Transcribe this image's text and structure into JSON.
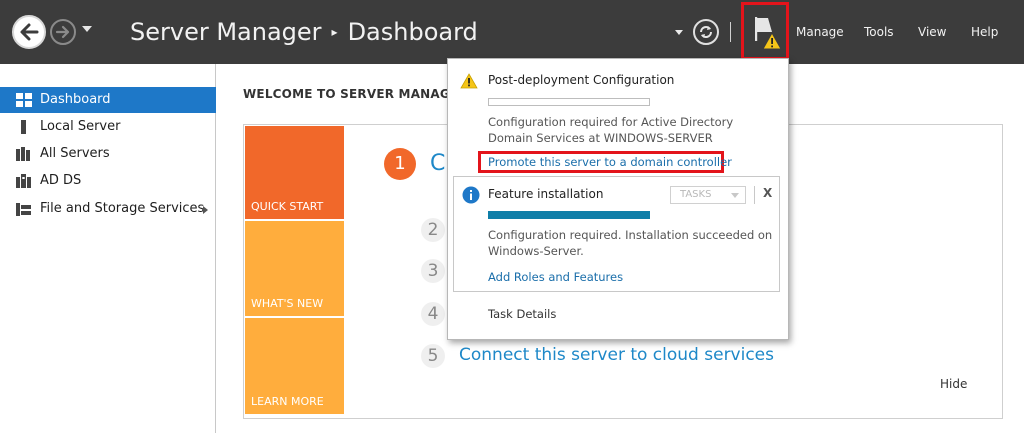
{
  "app": {
    "title": "Server Manager",
    "breadcrumb_separator": "▸",
    "breadcrumb_page": "Dashboard"
  },
  "menu": {
    "manage": "Manage",
    "tools": "Tools",
    "view": "View",
    "help": "Help"
  },
  "icons": {
    "back": "back-arrow-icon",
    "forward": "forward-arrow-icon",
    "refresh": "refresh-icon",
    "notifications": "flag-warning-icon"
  },
  "sidebar": {
    "items": [
      {
        "label": "Dashboard",
        "icon": "dashboard-icon",
        "active": true
      },
      {
        "label": "Local Server",
        "icon": "server-icon"
      },
      {
        "label": "All Servers",
        "icon": "servers-icon"
      },
      {
        "label": "AD DS",
        "icon": "ad-ds-icon"
      },
      {
        "label": "File and Storage Services",
        "icon": "storage-icon",
        "has_children": true
      }
    ]
  },
  "main": {
    "welcome": "WELCOME TO SERVER MANAGER",
    "tiles": [
      "QUICK START",
      "WHAT'S NEW",
      "LEARN MORE"
    ],
    "steps": {
      "first_number": "1",
      "first_title_visible": "C",
      "numbers": [
        "2",
        "3",
        "4",
        "5"
      ],
      "last_title": "Connect this server to cloud services"
    },
    "hide": "Hide"
  },
  "notifications": {
    "post_deploy": {
      "title": "Post-deployment Configuration",
      "progress": 0,
      "message": "Configuration required for Active Directory Domain Services at WINDOWS-SERVER",
      "link": "Promote this server to a domain controller"
    },
    "feature": {
      "title": "Feature installation",
      "tasks_label": "TASKS",
      "close_label": "X",
      "progress": 1,
      "message": "Configuration required. Installation succeeded on Windows-Server.",
      "link": "Add Roles and Features"
    },
    "task_details": "Task Details"
  },
  "colors": {
    "titlebar": "#3c3c3c",
    "sidebar_active": "#1e78c8",
    "quick_start": "#f1682a",
    "tile_secondary": "#ffad3d",
    "link": "#1a6eaa",
    "highlight": "#e3141b",
    "progress": "#0f7ea8"
  }
}
